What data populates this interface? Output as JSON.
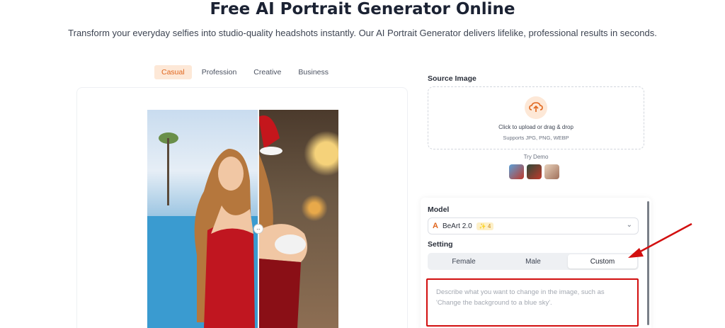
{
  "header": {
    "title": "Free AI Portrait Generator Online",
    "subtitle": "Transform your everyday selfies into studio-quality headshots instantly. Our AI Portrait Generator delivers lifelike, professional results in seconds."
  },
  "tabs": [
    {
      "label": "Casual",
      "active": true
    },
    {
      "label": "Profession"
    },
    {
      "label": "Creative"
    },
    {
      "label": "Business"
    }
  ],
  "source": {
    "label": "Source Image",
    "upload_text": "Click to upload or drag & drop",
    "upload_hint": "Supports JPG, PNG, WEBP",
    "upload_icon": "cloud-upload-icon",
    "try_demo": "Try Demo"
  },
  "model": {
    "label": "Model",
    "name": "BeArt 2.0",
    "credits": "4"
  },
  "setting": {
    "label": "Setting",
    "options": [
      {
        "label": "Female"
      },
      {
        "label": "Male"
      },
      {
        "label": "Custom",
        "selected": true
      }
    ]
  },
  "prompt": {
    "placeholder": "Describe what you want to change in the image, such as 'Change the background to a blue sky'."
  },
  "colors": {
    "accent": "#e0661e",
    "highlight": "#d20f0f"
  }
}
